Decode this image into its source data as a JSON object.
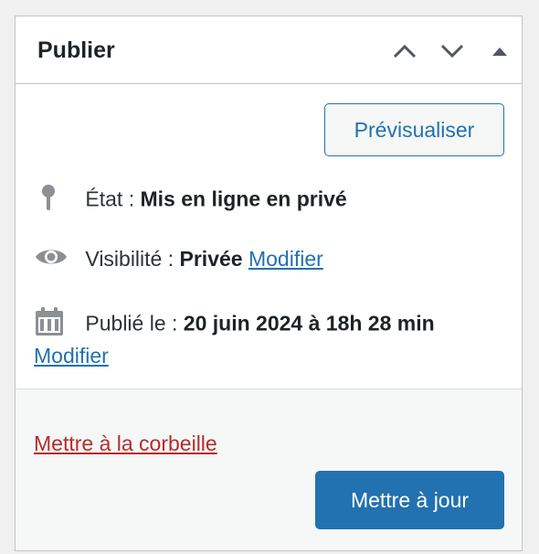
{
  "panel": {
    "title": "Publier",
    "controls": [
      "chevron-up-icon",
      "chevron-down-icon",
      "triangle-up-icon"
    ]
  },
  "actions": {
    "preview_label": "Prévisualiser"
  },
  "status": {
    "label": "État :",
    "value": "Mis en ligne en privé"
  },
  "visibility": {
    "label": "Visibilité :",
    "value": "Privée",
    "edit_label": "Modifier"
  },
  "published": {
    "label": "Publié le :",
    "value": "20 juin 2024 à 18h 28 min",
    "edit_label": "Modifier"
  },
  "footer": {
    "trash_label": "Mettre à la corbeille",
    "update_label": "Mettre à jour"
  },
  "colors": {
    "accent": "#2271b1",
    "danger": "#b32d2e",
    "icon_gray": "#8c8f94"
  }
}
